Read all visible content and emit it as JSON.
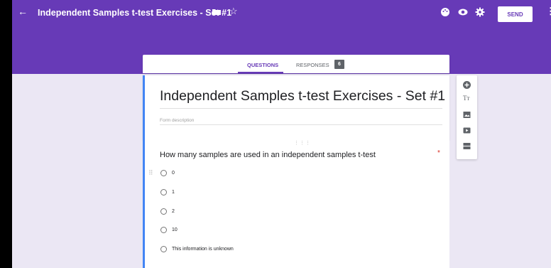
{
  "header": {
    "back_icon": "←",
    "title": "Independent Samples t-test Exercises - Set #1",
    "star_icon": "☆",
    "send_label": "SEND",
    "more_icon": "⋮",
    "accent_color": "#673ab7"
  },
  "tabs": {
    "questions_label": "QUESTIONS",
    "responses_label": "RESPONSES",
    "responses_count": "6"
  },
  "form": {
    "title": "Independent Samples t-test Exercises - Set #1",
    "description_placeholder": "Form description"
  },
  "question": {
    "text": "How many samples are used in an independent samples t-test",
    "required_marker": "*",
    "options": [
      "0",
      "1",
      "2",
      "10",
      "This information is unknown"
    ]
  },
  "side_toolbar": {
    "items": [
      "add-question-icon",
      "title-text-icon",
      "image-icon",
      "video-icon",
      "section-icon"
    ]
  }
}
